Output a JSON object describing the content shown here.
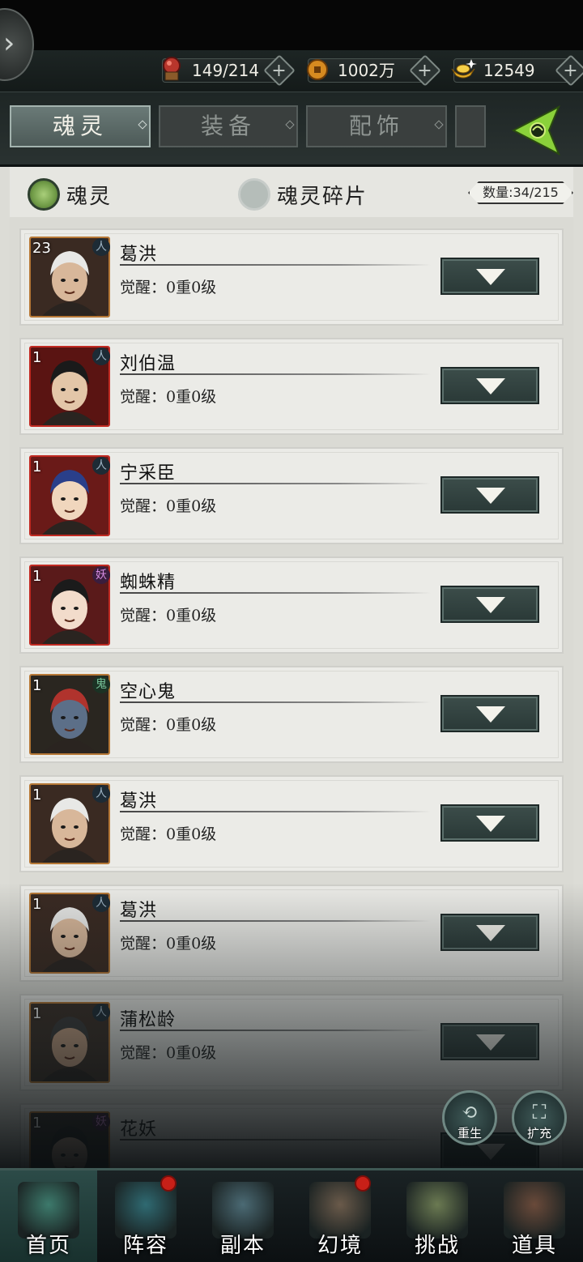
{
  "resources": [
    {
      "name": "soul-orb",
      "value": "149/214",
      "icon": "red-orb-icon"
    },
    {
      "name": "copper",
      "value": "1002万",
      "icon": "coin-icon"
    },
    {
      "name": "gold",
      "value": "12549",
      "icon": "ingot-icon"
    }
  ],
  "tabs": [
    {
      "label": "魂灵",
      "active": true
    },
    {
      "label": "装备",
      "active": false
    },
    {
      "label": "配饰",
      "active": false
    }
  ],
  "filter": {
    "option1": "魂灵",
    "option2": "魂灵碎片",
    "count": "数量:34/215"
  },
  "cards": [
    {
      "level": "23",
      "race": "人",
      "name": "葛洪",
      "awaken": "觉醒：0重0级",
      "frame": "gold",
      "skin": "#d8b79a",
      "hair": "#e8e8e6",
      "bg": "#3a2a22"
    },
    {
      "level": "1",
      "race": "人",
      "name": "刘伯温",
      "awaken": "觉醒：0重0级",
      "frame": "red",
      "skin": "#e3c6a8",
      "hair": "#1a1a1a",
      "bg": "#5a1412"
    },
    {
      "level": "1",
      "race": "人",
      "name": "宁采臣",
      "awaken": "觉醒：0重0级",
      "frame": "red",
      "skin": "#f0d6bd",
      "hair": "#2a3f8a",
      "bg": "#6a1a18"
    },
    {
      "level": "1",
      "race": "妖",
      "name": "蜘蛛精",
      "awaken": "觉醒：0重0级",
      "frame": "red",
      "skin": "#f2dccb",
      "hair": "#1b1b1b",
      "bg": "#5a1a1a"
    },
    {
      "level": "1",
      "race": "鬼",
      "name": "空心鬼",
      "awaken": "觉醒：0重0级",
      "frame": "gold",
      "skin": "#5c6f88",
      "hair": "#b0332d",
      "bg": "#2a2620"
    },
    {
      "level": "1",
      "race": "人",
      "name": "葛洪",
      "awaken": "觉醒：0重0级",
      "frame": "gold",
      "skin": "#d8b79a",
      "hair": "#e8e8e6",
      "bg": "#3a2a22"
    },
    {
      "level": "1",
      "race": "人",
      "name": "葛洪",
      "awaken": "觉醒：0重0级",
      "frame": "gold",
      "skin": "#d8b79a",
      "hair": "#e8e8e6",
      "bg": "#3a2a22"
    },
    {
      "level": "1",
      "race": "人",
      "name": "蒲松龄",
      "awaken": "觉醒：0重0级",
      "frame": "gold",
      "skin": "#caa385",
      "hair": "#3a3a3a",
      "bg": "#3a2e26"
    },
    {
      "level": "1",
      "race": "妖",
      "name": "花妖",
      "awaken": "",
      "frame": "gold",
      "skin": "#c9a792",
      "hair": "#222",
      "bg": "#2e2a26"
    }
  ],
  "actions": {
    "rebirth": "重生",
    "expand": "扩充"
  },
  "nav": [
    {
      "label": "首页",
      "active": true,
      "badge": false,
      "color": "#3d7a6c"
    },
    {
      "label": "阵容",
      "active": false,
      "badge": true,
      "color": "#2f6a72"
    },
    {
      "label": "副本",
      "active": false,
      "badge": false,
      "color": "#4b6a74"
    },
    {
      "label": "幻境",
      "active": false,
      "badge": true,
      "color": "#6a5a4a"
    },
    {
      "label": "挑战",
      "active": false,
      "badge": false,
      "color": "#6b7a52"
    },
    {
      "label": "道具",
      "active": false,
      "badge": false,
      "color": "#6a4a3a"
    }
  ]
}
